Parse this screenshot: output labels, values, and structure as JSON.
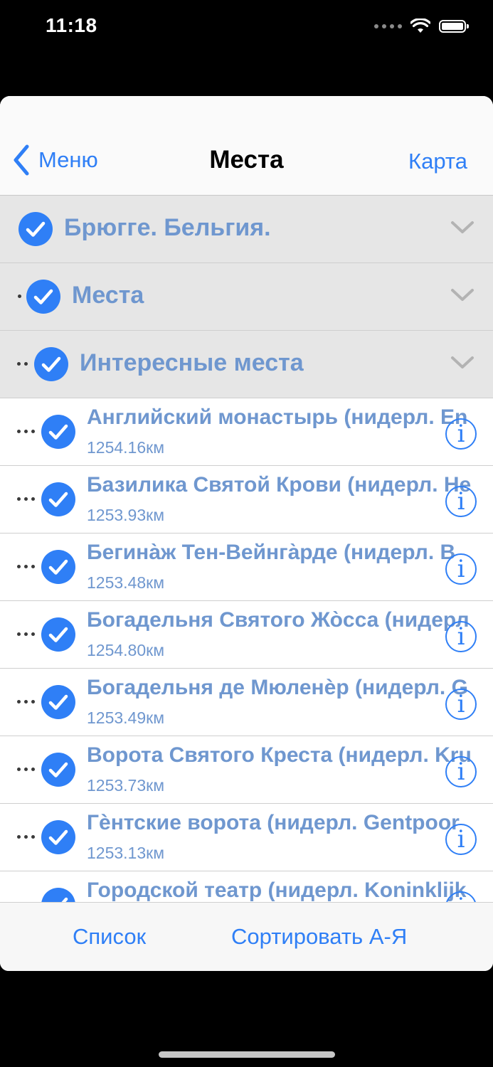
{
  "status": {
    "time": "11:18"
  },
  "nav": {
    "back_label": "Меню",
    "title": "Места",
    "right_label": "Карта"
  },
  "groups": [
    {
      "label": "Брюгге. Бельгия."
    },
    {
      "label": "Места"
    },
    {
      "label": "Интересные места"
    }
  ],
  "items": [
    {
      "title": "Английский монастырь (нидерл. En",
      "distance": "1254.16км"
    },
    {
      "title": "Базилика Святой Крови (нидерл. He",
      "distance": "1253.93км"
    },
    {
      "title": "Бегина̀ж Тен-Вейнга̀рде (нидерл. B",
      "distance": "1253.48км"
    },
    {
      "title": "Богадельня Святого Жо̀сса (нидерл",
      "distance": "1254.80км"
    },
    {
      "title": "Богадельня де Мюленѐр (нидерл. G",
      "distance": "1253.49км"
    },
    {
      "title": "Ворота Святого Креста (нидерл. Kru",
      "distance": "1253.73км"
    },
    {
      "title": "Гѐнтские ворота (нидерл. Gentpoor",
      "distance": "1253.13км"
    },
    {
      "title": "Городской театр (нидерл. Koninklijk",
      "distance": ""
    }
  ],
  "toolbar": {
    "list_label": "Список",
    "sort_label": "Сортировать А-Я"
  },
  "colors": {
    "accent": "#2f7ff6",
    "row_text": "#6f97cf",
    "group_bg": "#e6e6e6"
  },
  "icons": [
    "chevron-left-icon",
    "checkmark-icon",
    "chevron-down-icon",
    "info-icon",
    "wifi-icon",
    "battery-icon"
  ]
}
